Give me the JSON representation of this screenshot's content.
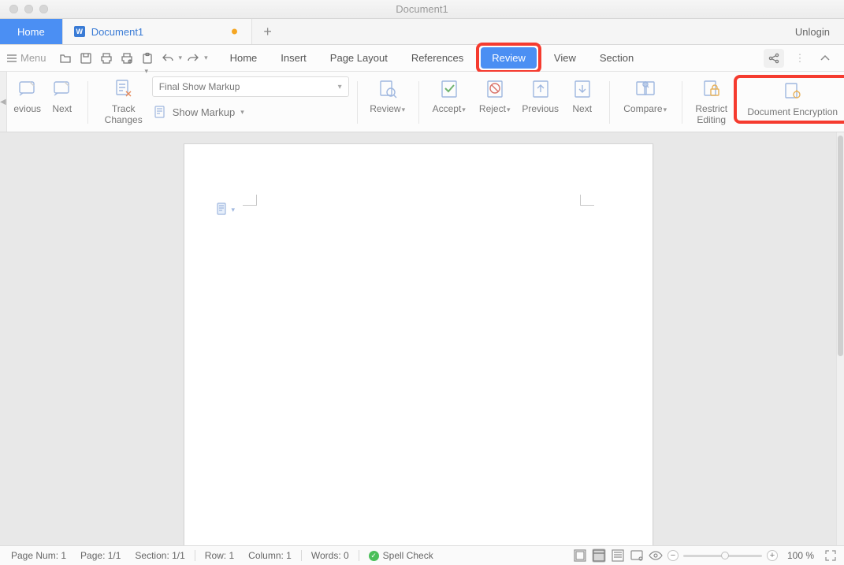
{
  "window": {
    "title": "Document1"
  },
  "tabs": {
    "home": "Home",
    "doc": "Document1",
    "plus": "+",
    "unlogin": "Unlogin"
  },
  "menu": {
    "label": "Menu",
    "items": [
      "Home",
      "Insert",
      "Page Layout",
      "References",
      "Review",
      "View",
      "Section"
    ],
    "active": "Review"
  },
  "ribbon": {
    "previous": "evious",
    "next": "Next",
    "track_changes": "Track\nChanges",
    "markup_combo": "Final Show Markup",
    "show_markup": "Show Markup",
    "review": "Review",
    "accept": "Accept",
    "reject": "Reject",
    "previous2": "Previous",
    "next2": "Next",
    "compare": "Compare",
    "restrict": "Restrict\nEditing",
    "doc_encryption": "Document Encryption"
  },
  "status": {
    "page_num": "Page Num: 1",
    "page": "Page: 1/1",
    "section": "Section: 1/1",
    "row": "Row: 1",
    "column": "Column: 1",
    "words": "Words: 0",
    "spell": "Spell Check",
    "zoom": "100 %"
  }
}
